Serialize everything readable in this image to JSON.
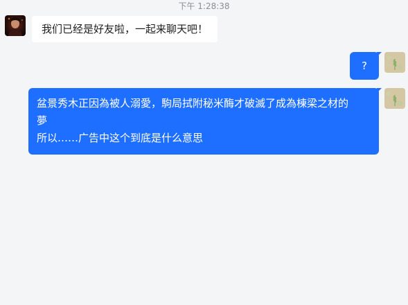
{
  "chat": {
    "timestamp": "下午 1:28:38",
    "messages": [
      {
        "side": "left",
        "text": "我们已经是好友啦，一起来聊天吧！"
      },
      {
        "side": "right",
        "text": "?"
      },
      {
        "side": "right",
        "lines": [
          "盆景秀木正因為被人溺愛，駒局拭附秘米酶才破滅了成為棟梁之材的",
          "夢",
          "所以……广告中这个到底是什么意思"
        ]
      }
    ]
  }
}
